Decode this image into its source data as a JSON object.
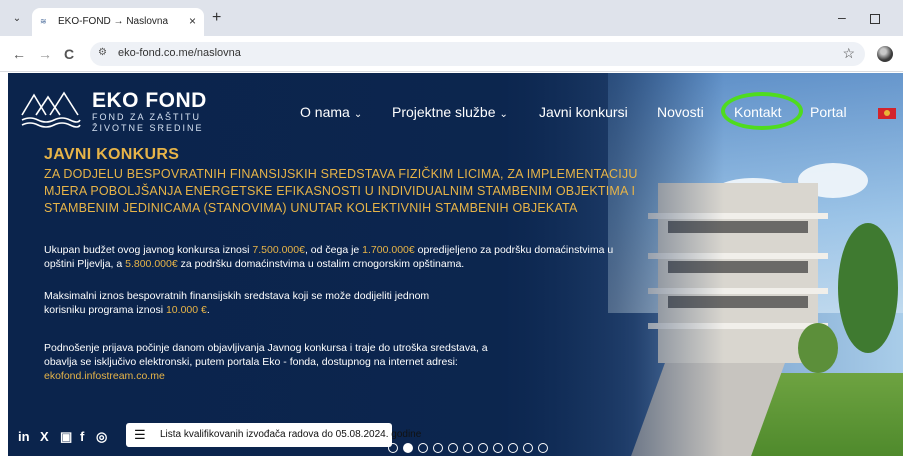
{
  "browser": {
    "tab_title": "EKO-FOND → Naslovna",
    "tab_close": "×",
    "new_tab": "+",
    "minimize": "–",
    "url": "eko-fond.co.me/naslovna",
    "back": "←",
    "forward": "→",
    "reload": "C",
    "star": "☆"
  },
  "site": {
    "logo_title": "EKO FOND",
    "logo_line1": "FOND ZA ZAŠTITU",
    "logo_line2": "ŽIVOTNE SREDINE",
    "nav": [
      {
        "label": "O nama",
        "caret": "⌄"
      },
      {
        "label": "Projektne službe",
        "caret": "⌄"
      },
      {
        "label": "Javni konkursi"
      },
      {
        "label": "Novosti"
      },
      {
        "label": "Kontakt"
      },
      {
        "label": "Portal"
      }
    ],
    "highlight_color": "#4fdc1e"
  },
  "hero": {
    "title": "JAVNI KONKURS",
    "subtitle": "ZA DODJELU BESPOVRATNIH FINANSIJSKIH SREDSTAVA FIZIČKIM LICIMA, ZA IMPLEMENTACIJU MJERA POBOLJŠANJA ENERGETSKE EFIKASNOSTI U INDIVIDUALNIM STAMBENIM OBJEKTIMA I STAMBENIM JEDINICAMA (STANOVIMA) UNUTAR KOLEKTIVNIH STAMBENIH OBJEKATA",
    "p1": {
      "a": "Ukupan budžet ovog javnog konkursa iznosi ",
      "b": "7.500.000€",
      "c": ", od čega je ",
      "d": "1.700.000€",
      "e": " opredijeljeno za podršku domaćinstvima u opštini Pljevlja, a ",
      "f": "5.800.000€",
      "g": " za podršku domaćinstvima u ostalim crnogorskim opštinama."
    },
    "p2": {
      "a": "Maksimalni iznos bespovratnih finansijskih sredstava koji se može dodijeliti jednom korisniku programa iznosi ",
      "b": "10.000 €",
      "c": "."
    },
    "p3": {
      "a": "Podnošenje prijava počinje danom objavljivanja Javnog konkursa i traje do utroška sredstava, a obavlja se isključivo elektronski, putem portala Eko - fonda, dostupnog na internet adresi: ",
      "b": "ekofond.infostream.co.me"
    },
    "accent_color": "#e7b448"
  },
  "bottom": {
    "social": [
      "in",
      "X",
      "▣",
      "f",
      "◎"
    ],
    "pill_icon": "☰",
    "pill_text": "Lista kvalifikovanih izvođača radova do 05.08.2024. godine",
    "slides": 11,
    "active_slide": 1
  }
}
